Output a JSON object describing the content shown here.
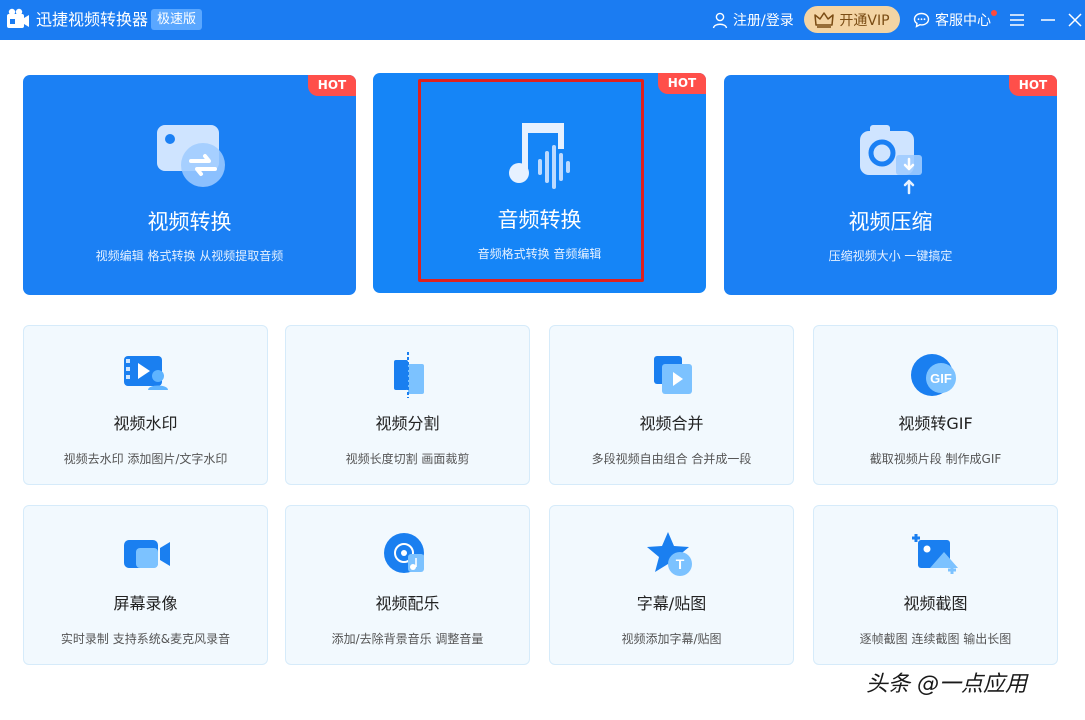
{
  "app": {
    "title": "迅捷视频转换器",
    "edition_badge": "极速版"
  },
  "header": {
    "login_label": "注册/登录",
    "vip_label": "开通VIP",
    "service_label": "客服中心"
  },
  "feature_cards": [
    {
      "title": "视频转换",
      "subtitle": "视频编辑 格式转换 从视频提取音频",
      "tag": "HOT"
    },
    {
      "title": "音频转换",
      "subtitle": "音频格式转换 音频编辑",
      "tag": "HOT"
    },
    {
      "title": "视频压缩",
      "subtitle": "压缩视频大小 一键搞定",
      "tag": "HOT"
    }
  ],
  "tools": [
    {
      "title": "视频水印",
      "subtitle": "视频去水印 添加图片/文字水印"
    },
    {
      "title": "视频分割",
      "subtitle": "视频长度切割 画面裁剪"
    },
    {
      "title": "视频合并",
      "subtitle": "多段视频自由组合 合并成一段"
    },
    {
      "title": "视频转GIF",
      "subtitle": "截取视频片段 制作成GIF",
      "icon_text": "GIF"
    },
    {
      "title": "屏幕录像",
      "subtitle": "实时录制 支持系统&麦克风录音"
    },
    {
      "title": "视频配乐",
      "subtitle": "添加/去除背景音乐 调整音量"
    },
    {
      "title": "字幕/贴图",
      "subtitle": "视频添加字幕/贴图",
      "icon_text": "T"
    },
    {
      "title": "视频截图",
      "subtitle": "逐帧截图 连续截图 输出长图"
    }
  ],
  "watermark": "头条 @一点应用",
  "colors": {
    "titlebar": "#1b7cf2",
    "feature_card": "#1b80f4",
    "hot_tag": "#ff4f4a",
    "highlight_border": "#e0201e",
    "tool_card_bg": "#f2f9fe",
    "vip_button": "#f3d4a4"
  }
}
